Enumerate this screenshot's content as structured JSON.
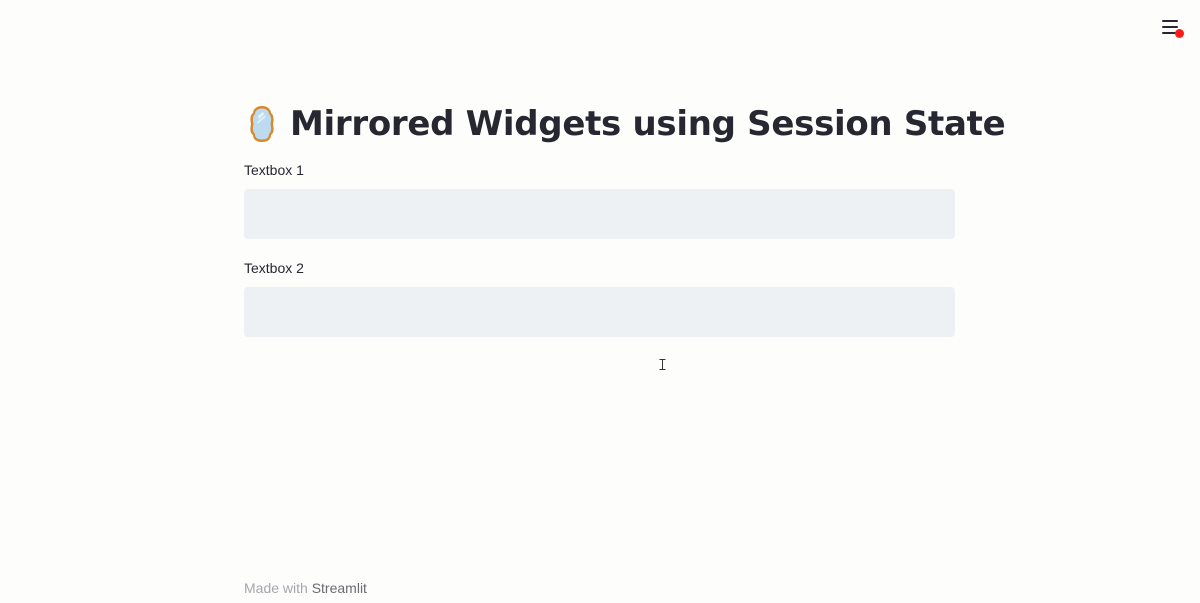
{
  "header": {
    "menu_icon": "hamburger-menu-icon",
    "notification_dot_color": "#ff1a1a"
  },
  "main": {
    "title_icon": "mirror-icon",
    "title": "Mirrored Widgets using Session State",
    "textbox1": {
      "label": "Textbox 1",
      "value": ""
    },
    "textbox2": {
      "label": "Textbox 2",
      "value": ""
    }
  },
  "footer": {
    "prefix": "Made with",
    "brand": "Streamlit"
  },
  "colors": {
    "background": "#fdfdfc",
    "text": "#262730",
    "input_background": "#eef1f4",
    "footer_text": "#a5a5ad"
  }
}
